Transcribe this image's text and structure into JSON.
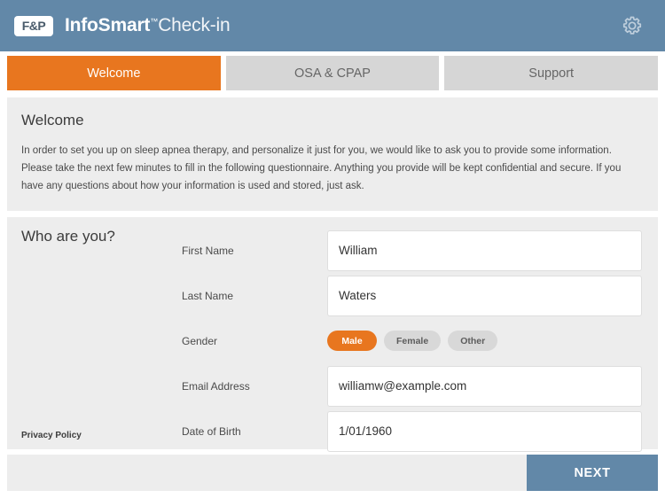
{
  "header": {
    "logo_badge": "F&P",
    "brand_primary": "InfoSmart",
    "brand_tm": "™",
    "brand_secondary": "Check-in",
    "settings_icon": "gear-icon",
    "bg_color": "#6288a8"
  },
  "tabs": [
    {
      "label": "Welcome",
      "active": true
    },
    {
      "label": "OSA & CPAP",
      "active": false
    },
    {
      "label": "Support",
      "active": false
    }
  ],
  "welcome_panel": {
    "title": "Welcome",
    "body": "In order to set you up on sleep apnea therapy, and personalize it just for you, we would like to ask you to provide some information. Please take the next few minutes to fill in the following questionnaire. Anything you provide will be kept confidential and secure. If you have any questions about how your information is used and stored, just ask."
  },
  "form_panel": {
    "title": "Who are you?",
    "privacy_policy_label": "Privacy Policy",
    "fields": {
      "first_name": {
        "label": "First Name",
        "value": "William"
      },
      "last_name": {
        "label": "Last Name",
        "value": "Waters"
      },
      "gender": {
        "label": "Gender",
        "options": [
          {
            "label": "Male",
            "selected": true
          },
          {
            "label": "Female",
            "selected": false
          },
          {
            "label": "Other",
            "selected": false
          }
        ]
      },
      "email": {
        "label": "Email Address",
        "value": "williamw@example.com"
      },
      "dob": {
        "label": "Date of Birth",
        "value": "1/01/1960"
      }
    }
  },
  "footer": {
    "next_label": "NEXT"
  },
  "colors": {
    "accent_orange": "#e8761f",
    "brand_blue": "#6288a8",
    "panel_gray": "#ededed",
    "tab_inactive": "#d6d6d6"
  }
}
